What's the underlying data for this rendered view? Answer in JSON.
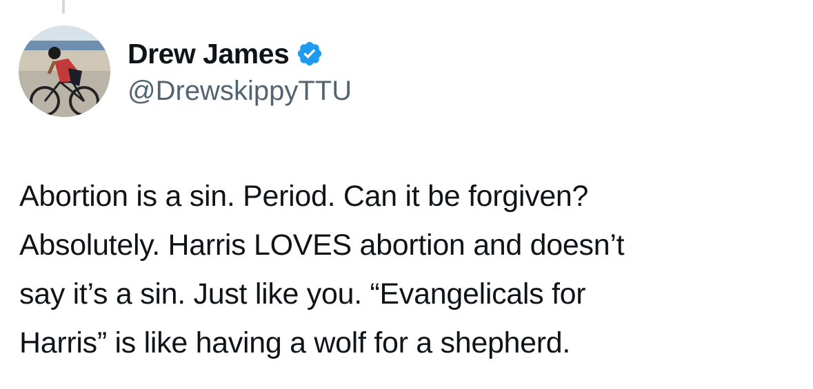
{
  "tweet": {
    "author": {
      "display_name": "Drew James",
      "handle": "@DrewskippyTTU",
      "verified": true,
      "verified_icon": "verified-badge-icon",
      "verified_color": "#1d9bf0"
    },
    "text_lines": [
      "Abortion is a sin. Period. Can it be forgiven?",
      "Absolutely. Harris LOVES abortion and doesn’t",
      "say it’s a sin. Just like you. “Evangelicals for",
      "Harris” is like having a wolf for a shepherd."
    ]
  },
  "colors": {
    "text_primary": "#0f1419",
    "text_secondary": "#536471",
    "thread_line": "#cfd9de"
  }
}
